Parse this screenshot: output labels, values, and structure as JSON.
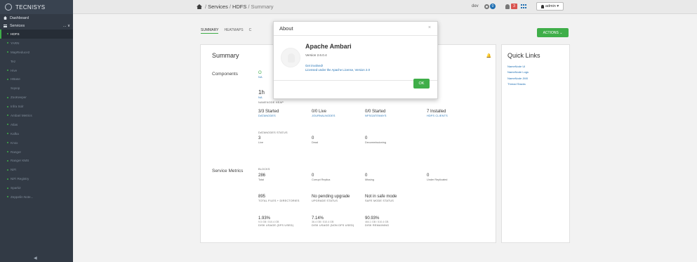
{
  "brand": {
    "name": "TECNISYS"
  },
  "sidebar": {
    "dashboard_label": "Dashboard",
    "services_label": "Services",
    "services_more": "... ∨",
    "items": [
      {
        "label": "HDFS",
        "dot": true,
        "active": true
      },
      {
        "label": "YARN",
        "dot": true
      },
      {
        "label": "MapReduce2",
        "dot": true
      },
      {
        "label": "Tez",
        "dot": false
      },
      {
        "label": "Hive",
        "dot": true
      },
      {
        "label": "HBase",
        "dot": true
      },
      {
        "label": "Sqoop",
        "dot": false
      },
      {
        "label": "ZooKeeper",
        "dot": true
      },
      {
        "label": "Infra Solr",
        "dot": true
      },
      {
        "label": "Ambari Metrics",
        "dot": true
      },
      {
        "label": "Atlas",
        "dot": true
      },
      {
        "label": "Kafka",
        "dot": true
      },
      {
        "label": "Knox",
        "dot": true
      },
      {
        "label": "Ranger",
        "dot": true
      },
      {
        "label": "Ranger KMS",
        "dot": true
      },
      {
        "label": "NiFi",
        "dot": true
      },
      {
        "label": "NiFi Registry",
        "dot": true
      },
      {
        "label": "Spark2",
        "dot": true
      },
      {
        "label": "Zeppelin Note...",
        "dot": true
      }
    ],
    "collapse_icon": "◀"
  },
  "header": {
    "breadcrumb": {
      "root": "Services",
      "sep1": "/",
      "service": "HDFS",
      "sep2": "/",
      "page": "Summary"
    },
    "cluster_name": "dev",
    "ops_count": "0",
    "alerts_count": "3",
    "user_label": "admin ▾"
  },
  "tabs": [
    {
      "label": "SUMMARY"
    },
    {
      "label": "HEATMAPS"
    },
    {
      "label": "C"
    }
  ],
  "actions_label": "ACTIONS ⌄",
  "summary": {
    "title": "Summary",
    "components_label": "Components",
    "service_metrics_label": "Service Metrics",
    "rows": {
      "r1_a": {
        "v": "O",
        "l": "NA"
      },
      "r2_a": {
        "v": "1h",
        "l": "NA"
      },
      "namenode_heap": "NAMENODE HEAP",
      "started_datanodes": {
        "v": "3/3 Started",
        "l": "DATANODES"
      },
      "journal": {
        "v": "0/0 Live",
        "l": "JOURNALNODES"
      },
      "nfs": {
        "v": "0/0 Started",
        "l": "NFSGATEWAYS"
      },
      "clients": {
        "v": "7 Installed",
        "l": "HDFS CLIENTS"
      },
      "datanodes_status": "DATANODES STATUS",
      "dn_live": {
        "v": "3",
        "l": "Live"
      },
      "dn_dead": {
        "v": "0",
        "l": "Dead"
      },
      "dn_decom": {
        "v": "0",
        "l": "Decommissioning"
      },
      "blocks_label": "BLOCKS",
      "blocks_total": {
        "v": "286",
        "l": "Total"
      },
      "blocks_corrupt": {
        "v": "0",
        "l": "Corrupt Replica"
      },
      "blocks_missing": {
        "v": "0",
        "l": "Missing"
      },
      "blocks_under": {
        "v": "0",
        "l": "Under Replicated"
      },
      "files": {
        "v": "895",
        "l": "TOTAL FILES + DIRECTORIES"
      },
      "upgrade": {
        "v": "No pending upgrade",
        "l": "UPGRADE STATUS"
      },
      "safemode": {
        "v": "Not in safe mode",
        "l": "SAFE MODE STATUS"
      },
      "dfs_used": {
        "v": "1.93%",
        "sub": "9.5 GB / 510.4 GB",
        "l": "DISK USAGE (DFS USED)"
      },
      "non_dfs": {
        "v": "7.14%",
        "sub": "36.4 GB / 510.4 GB",
        "l": "DISK USAGE (NON DFS USED)"
      },
      "remaining": {
        "v": "90.93%",
        "sub": "464.1 GB / 510.4 GB",
        "l": "DISK REMAINING"
      }
    }
  },
  "quick_links": {
    "title": "Quick Links",
    "items": [
      "NameNode UI",
      "NameNode Logs",
      "NameNode JMX",
      "Thread Stacks"
    ]
  },
  "modal": {
    "title": "About",
    "close": "×",
    "product": "Apache Ambari",
    "version": "Version 2.6.0.4",
    "link_involved": "Get involved!",
    "link_license": "Licensed under the Apache License, Version 2.0",
    "ok_label": "OK"
  }
}
